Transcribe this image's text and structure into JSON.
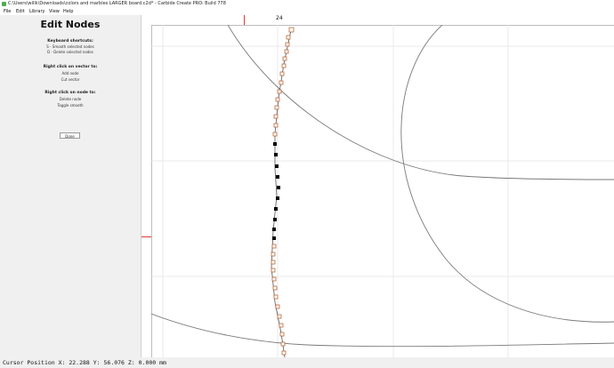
{
  "window": {
    "title": "C:\\Users\\willk\\Downloads\\colors and marbles LARGER board.c2d* - Carbide Create PRO: Build 778"
  },
  "menu": {
    "items": [
      "File",
      "Edit",
      "Library",
      "View",
      "Help"
    ]
  },
  "sidebar": {
    "heading": "Edit Nodes",
    "keyboard": {
      "title": "Keyboard shortcuts:",
      "lines": [
        "S - Smooth selected nodes",
        "D - Delete selected nodes"
      ]
    },
    "vector": {
      "title": "Right click on vector to:",
      "lines": [
        "Add node",
        "Cut vector"
      ]
    },
    "node": {
      "title": "Right click on node to:",
      "lines": [
        "Delete node",
        "Toggle smooth"
      ]
    },
    "done_label": "Done"
  },
  "ruler": {
    "top_label": "24"
  },
  "colors": {
    "ruler_marker": "#e53935",
    "node_open": "#b3541e",
    "node_selected": "#000000",
    "vector": "#777777"
  },
  "status": {
    "cursor_position": "Cursor Position X: 22.288 Y: 56.076 Z: 0.000 mm"
  }
}
